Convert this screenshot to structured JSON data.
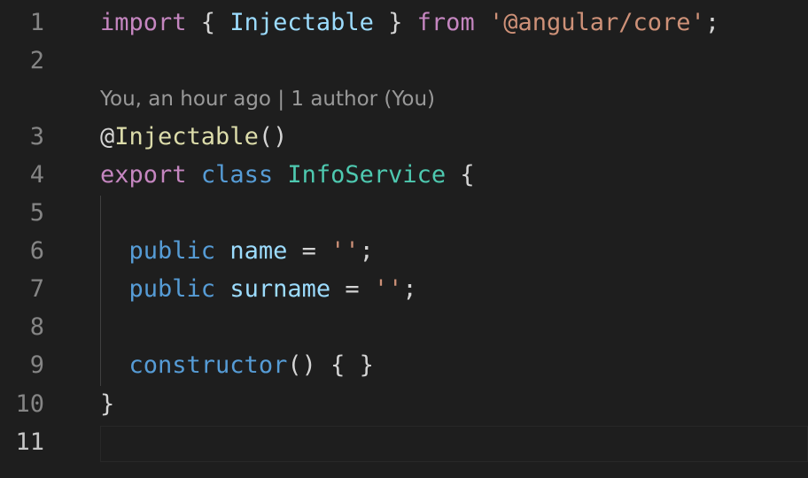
{
  "codelens": "You, an hour ago | 1 author (You)",
  "lines": [
    {
      "number": "1",
      "tokens": [
        "import",
        " { ",
        "Injectable",
        " } ",
        "from",
        " ",
        "'@angular/core'",
        ";"
      ]
    },
    {
      "number": "2",
      "tokens": []
    },
    {
      "number": "3",
      "tokens": [
        "@",
        "Injectable",
        "()"
      ]
    },
    {
      "number": "4",
      "tokens": [
        "export",
        " ",
        "class",
        " ",
        "InfoService",
        " {"
      ]
    },
    {
      "number": "5",
      "tokens": []
    },
    {
      "number": "6",
      "tokens": [
        "  ",
        "public",
        " ",
        "name",
        " = ",
        "''",
        ";"
      ]
    },
    {
      "number": "7",
      "tokens": [
        "  ",
        "public",
        " ",
        "surname",
        " = ",
        "''",
        ";"
      ]
    },
    {
      "number": "8",
      "tokens": []
    },
    {
      "number": "9",
      "tokens": [
        "  ",
        "constructor",
        "() { }"
      ]
    },
    {
      "number": "10",
      "tokens": [
        "}"
      ]
    },
    {
      "number": "11",
      "tokens": []
    }
  ],
  "colors": {
    "background": "#1e1e1e",
    "keyword_control": "#c586c0",
    "keyword": "#569cd6",
    "type": "#4ec9b0",
    "variable": "#9cdcfe",
    "string": "#ce9178",
    "line_number": "#858585",
    "codelens": "#999999"
  }
}
